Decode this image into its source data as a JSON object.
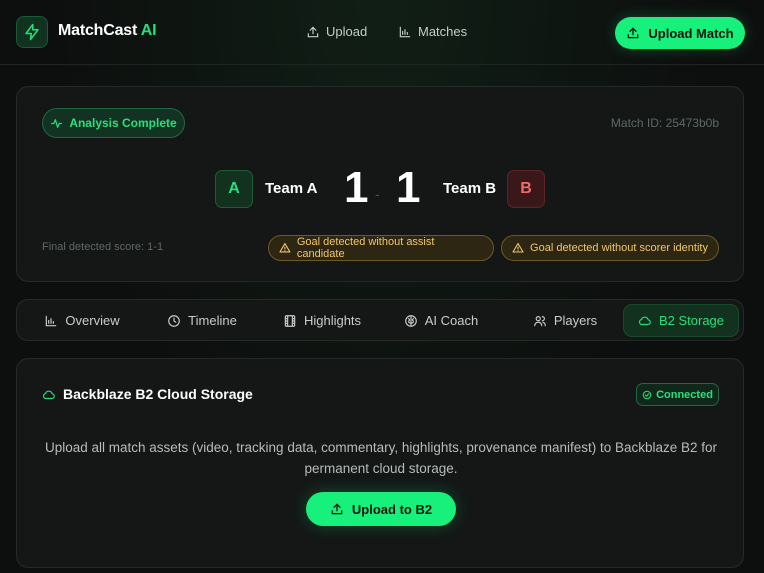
{
  "header": {
    "brand_main": "MatchCast",
    "brand_accent": "AI",
    "nav": [
      {
        "label": "Upload",
        "icon": "upload-icon"
      },
      {
        "label": "Matches",
        "icon": "bar-chart-icon"
      }
    ],
    "cta_label": "Upload Match"
  },
  "match": {
    "status": "Analysis Complete",
    "match_id": "Match ID: 25473b0b",
    "team_a": {
      "badge": "A",
      "name": "Team A",
      "score": "1"
    },
    "team_b": {
      "badge": "B",
      "name": "Team B",
      "score": "1"
    },
    "score_separator": "-",
    "final_score_text": "Final detected score: 1-1",
    "warnings": [
      "Goal detected without assist candidate",
      "Goal detected without scorer identity"
    ]
  },
  "tabs": [
    {
      "label": "Overview",
      "icon": "bar-chart-icon",
      "active": false
    },
    {
      "label": "Timeline",
      "icon": "clock-icon",
      "active": false
    },
    {
      "label": "Highlights",
      "icon": "film-icon",
      "active": false
    },
    {
      "label": "AI Coach",
      "icon": "brain-icon",
      "active": false
    },
    {
      "label": "Players",
      "icon": "users-icon",
      "active": false
    },
    {
      "label": "B2 Storage",
      "icon": "cloud-icon",
      "active": true
    }
  ],
  "storage": {
    "title": "Backblaze B2 Cloud Storage",
    "status": "Connected",
    "description": "Upload all match assets (video, tracking data, commentary, highlights, provenance manifest) to Backblaze B2 for permanent cloud storage.",
    "button_label": "Upload to B2"
  },
  "colors": {
    "accent": "#18f07c",
    "background": "#0d0f0e",
    "card": "#141716",
    "warning": "#f0c76a",
    "team_b": "#f06a6a"
  }
}
